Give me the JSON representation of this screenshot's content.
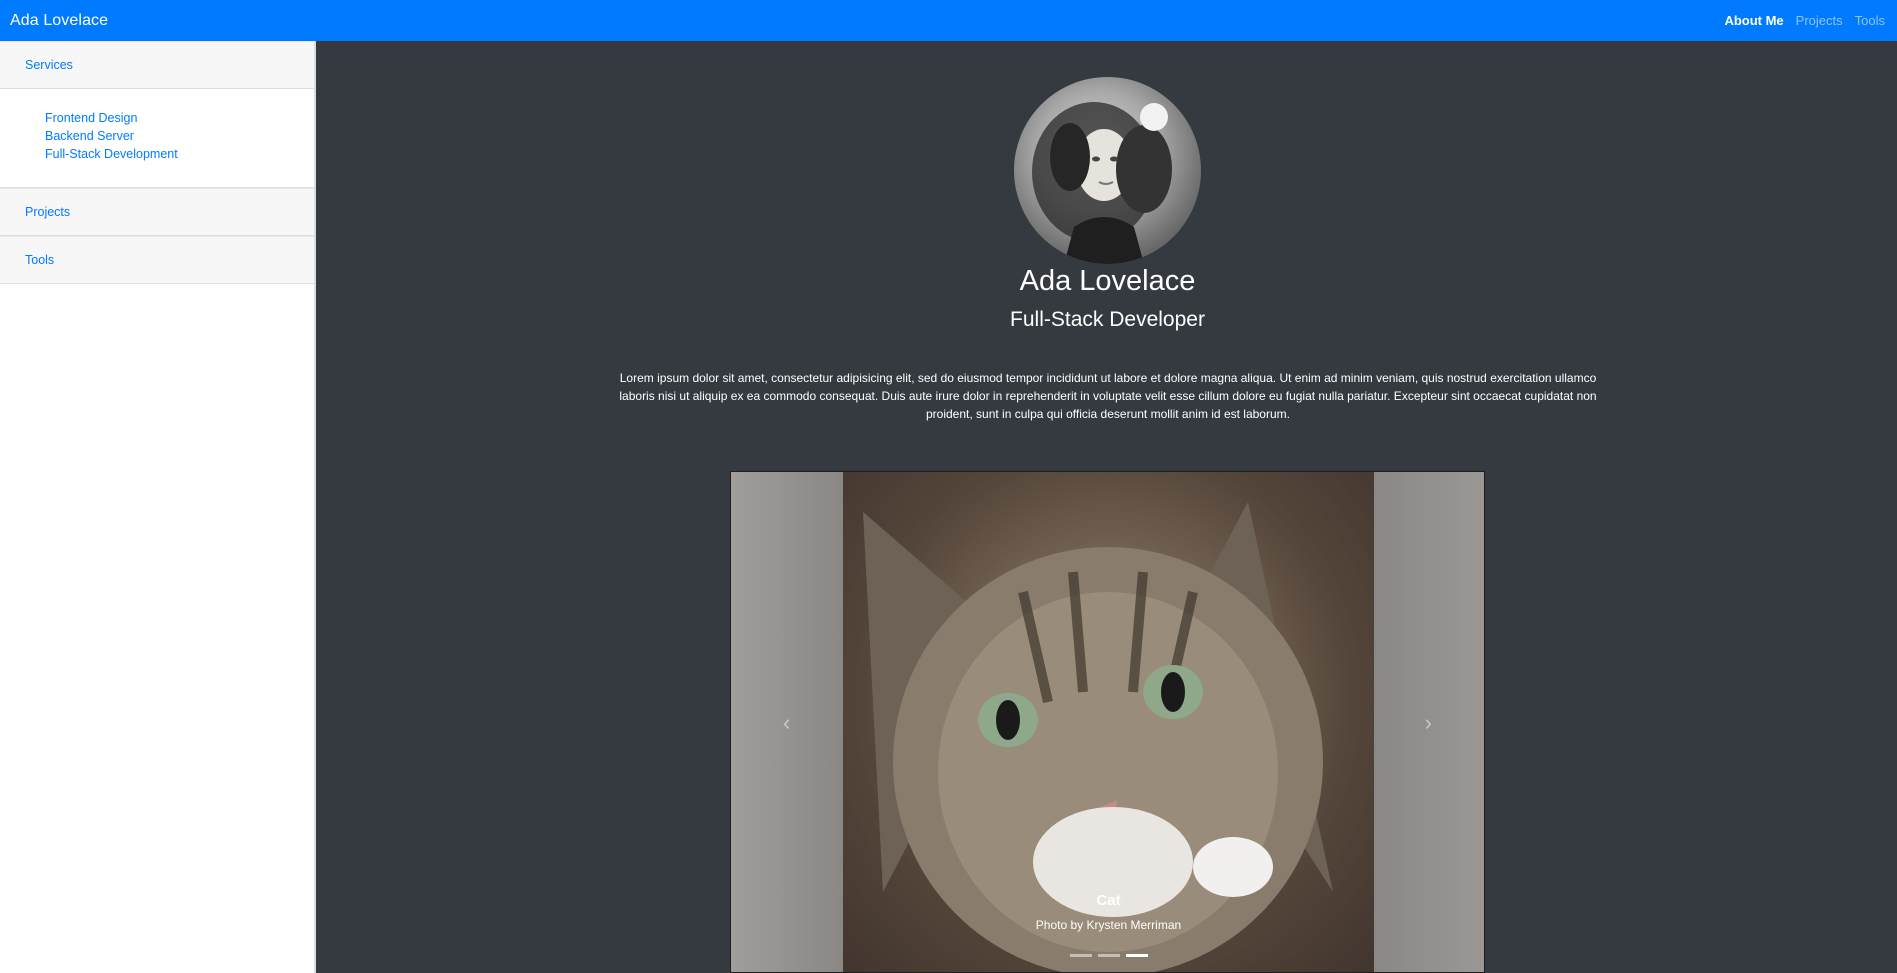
{
  "navbar": {
    "brand": "Ada Lovelace",
    "links": [
      {
        "label": "About Me",
        "active": true
      },
      {
        "label": "Projects",
        "active": false
      },
      {
        "label": "Tools",
        "active": false
      }
    ]
  },
  "sidebar": {
    "sections": [
      {
        "label": "Services",
        "items": [
          "Frontend Design",
          "Backend Server",
          "Full-Stack Development"
        ]
      },
      {
        "label": "Projects"
      },
      {
        "label": "Tools"
      }
    ]
  },
  "profile": {
    "name": "Ada Lovelace",
    "title": "Full-Stack Developer",
    "bio": "Lorem ipsum dolor sit amet, consectetur adipisicing elit, sed do eiusmod tempor incididunt ut labore et dolore magna aliqua. Ut enim ad minim veniam, quis nostrud exercitation ullamco laboris nisi ut aliquip ex ea commodo consequat. Duis aute irure dolor in reprehenderit in voluptate velit esse cillum dolore eu fugiat nulla pariatur. Excepteur sint occaecat cupidatat non proident, sunt in culpa qui officia deserunt mollit anim id est laborum."
  },
  "carousel": {
    "caption_title": "Cat",
    "caption_sub": "Photo by Krysten Merriman",
    "slide_count": 3,
    "active_index": 2
  },
  "colors": {
    "primary": "#007bff",
    "background_dark": "#343a40"
  }
}
